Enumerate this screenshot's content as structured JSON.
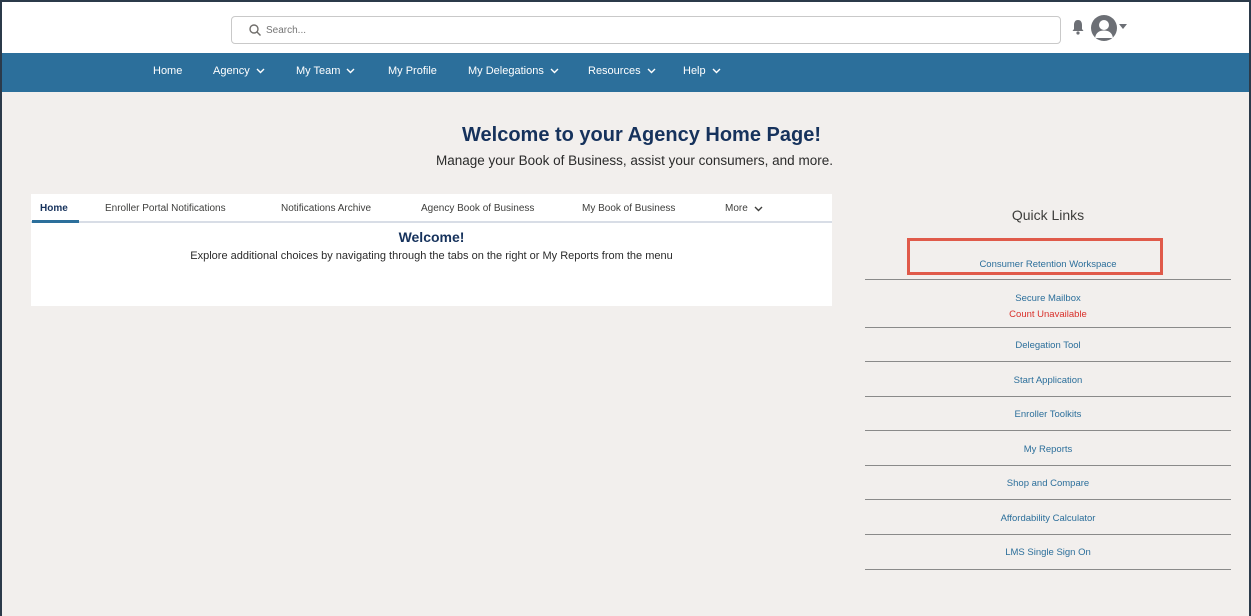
{
  "search": {
    "placeholder": "Search..."
  },
  "icons": {
    "search": "search-icon",
    "bell": "bell-icon",
    "avatar": "user-avatar-icon",
    "caret": "caret-down-icon"
  },
  "colors": {
    "nav": "#2c6f9b",
    "link": "#2c6f9b",
    "warn": "#d9302a",
    "highlight": "#e05a4a",
    "background": "#f2efed"
  },
  "nav": {
    "home": "Home",
    "agency": "Agency",
    "my_team": "My Team",
    "my_profile": "My Profile",
    "my_delegations": "My Delegations",
    "resources": "Resources",
    "help": "Help"
  },
  "hero": {
    "title": "Welcome to your Agency Home Page!",
    "subtitle": "Manage your Book of Business, assist your consumers, and more."
  },
  "tabs": {
    "home": "Home",
    "enroller_portal_notifications": "Enroller Portal Notifications",
    "notifications_archive": "Notifications Archive",
    "agency_book": "Agency Book of Business",
    "my_book": "My Book of Business",
    "more": "More"
  },
  "welcome": {
    "title": "Welcome!",
    "text": "Explore additional choices by navigating through the tabs on the right or My Reports from the menu"
  },
  "quick_links": {
    "title": "Quick Links",
    "consumer_retention": "Consumer Retention Workspace",
    "secure_mailbox": "Secure Mailbox",
    "count_unavailable": "Count Unavailable",
    "delegation_tool": "Delegation Tool",
    "start_application": "Start Application",
    "enroller_toolkits": "Enroller Toolkits",
    "my_reports": "My Reports",
    "shop_and_compare": "Shop and Compare",
    "affordability_calculator": "Affordability Calculator",
    "lms_single_sign_on": "LMS Single Sign On"
  }
}
